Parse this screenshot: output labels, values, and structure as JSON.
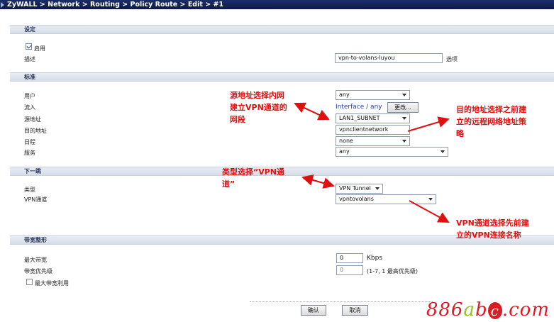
{
  "breadcrumb": "ZyWALL > Network > Routing > Policy Route > Edit > #1",
  "sections": {
    "settings": "设定",
    "criteria": "标准",
    "next_hop": "下一跳",
    "bandwidth": "带宽整形"
  },
  "settings": {
    "enable_label": "启用",
    "enable_checked": true,
    "description_label": "描述",
    "description_value": "vpn-to-volans-luyou",
    "optional_label": "选项"
  },
  "criteria": {
    "user_label": "用户",
    "user_value": "any",
    "incoming_label": "流入",
    "incoming_value": "Interface / any",
    "change_button": "更改...",
    "source_label": "源地址",
    "source_value": "LAN1_SUBNET",
    "destination_label": "目的地址",
    "destination_value": "vpnclientnetwork",
    "schedule_label": "日程",
    "schedule_value": "none",
    "service_label": "服务",
    "service_value": "any"
  },
  "next_hop": {
    "type_label": "类型",
    "type_value": "VPN Tunnel",
    "vpn_label": "VPN通道",
    "vpn_value": "vpntovolans"
  },
  "bandwidth": {
    "max_label": "最大带宽",
    "max_value": "0",
    "max_unit": "Kbps",
    "priority_label": "带宽优先级",
    "priority_value": "0",
    "priority_hint": "(1-7, 1 最高优先级)",
    "max_usage_label": "最大带宽利用",
    "max_usage_checked": false
  },
  "buttons": {
    "ok": "确认",
    "cancel": "取消"
  },
  "annotations": {
    "source_note": [
      "源地址选择内网",
      "建立VPN通道的",
      "网段"
    ],
    "destination_note": [
      "目的地址选择之前建",
      "立的远程网络地址策",
      "略"
    ],
    "type_note": [
      "类型选择“VPN通",
      "道”"
    ],
    "vpn_note": [
      "VPN通道选择先前建",
      "立的VPN连接名称"
    ]
  },
  "watermark": {
    "part1": "886",
    "part2": "a",
    "part3": "b",
    "part4": "c",
    "part5": ".com"
  },
  "colors": {
    "annotation": "#e01010",
    "title_bar": "#1c2e6a",
    "section_bg": "#dfe5ee"
  }
}
